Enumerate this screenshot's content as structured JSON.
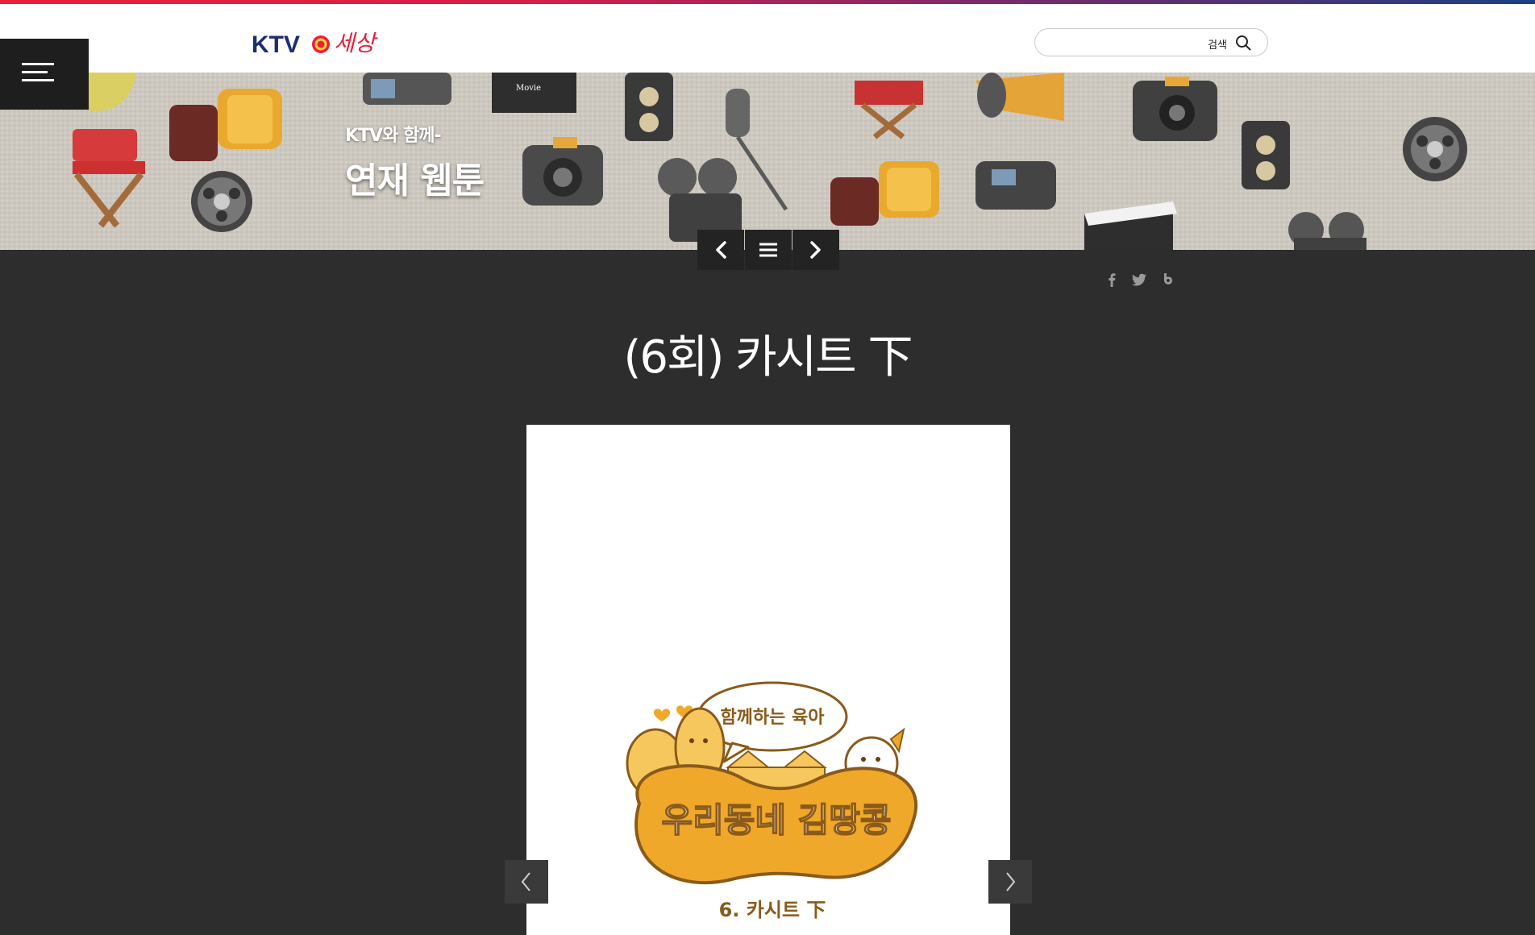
{
  "header": {
    "logo_text": "KTV",
    "logo_script": "세상",
    "search": {
      "placeholder": "",
      "button_label": "검색"
    }
  },
  "banner": {
    "subtitle": "KTV와 함께-",
    "title": "연재 웹툰"
  },
  "article": {
    "title": "(6회) 카시트 下"
  },
  "comic": {
    "bubble_text": "함께하는 육아",
    "series_title": "우리동네 김땅콩",
    "episode_label": "6. 카시트 下"
  },
  "share": [
    "facebook-icon",
    "twitter-icon",
    "blog-icon"
  ],
  "colors": {
    "accent_red": "#e8203c",
    "page_bg": "#2d2d2d",
    "comic_orange": "#f0a82a"
  }
}
